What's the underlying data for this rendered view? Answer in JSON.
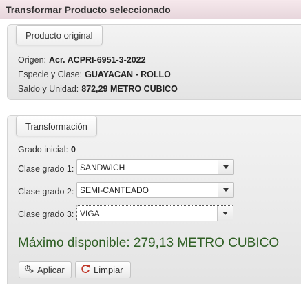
{
  "title": "Transformar Producto seleccionado",
  "original": {
    "legend": "Producto original",
    "origen_label": "Origen:",
    "origen_value": "Acr. ACPRI-6951-3-2022",
    "especie_label": "Especie y Clase:",
    "especie_value": "GUAYACAN - ROLLO",
    "saldo_label": "Saldo y Unidad:",
    "saldo_value": "872,29 METRO CUBICO"
  },
  "transform": {
    "legend": "Transformación",
    "grado_label": "Grado inicial:",
    "grado_value": "0",
    "clase1_label": "Clase grado 1:",
    "clase1_value": "SANDWICH",
    "clase2_label": "Clase grado 2:",
    "clase2_value": "SEMI-CANTEADO",
    "clase3_label": "Clase grado 3:",
    "clase3_value": "VIGA",
    "maximo_label": "Máximo disponible:",
    "maximo_value": "279,13",
    "maximo_unit": "METRO CUBICO"
  },
  "buttons": {
    "apply": "Aplicar",
    "clear": "Limpiar"
  },
  "icons": {
    "apply": "gears-icon",
    "clear": "refresh-icon"
  },
  "colors": {
    "maximo_text": "#2f5f24",
    "titlebar": "#f0e0e5"
  }
}
